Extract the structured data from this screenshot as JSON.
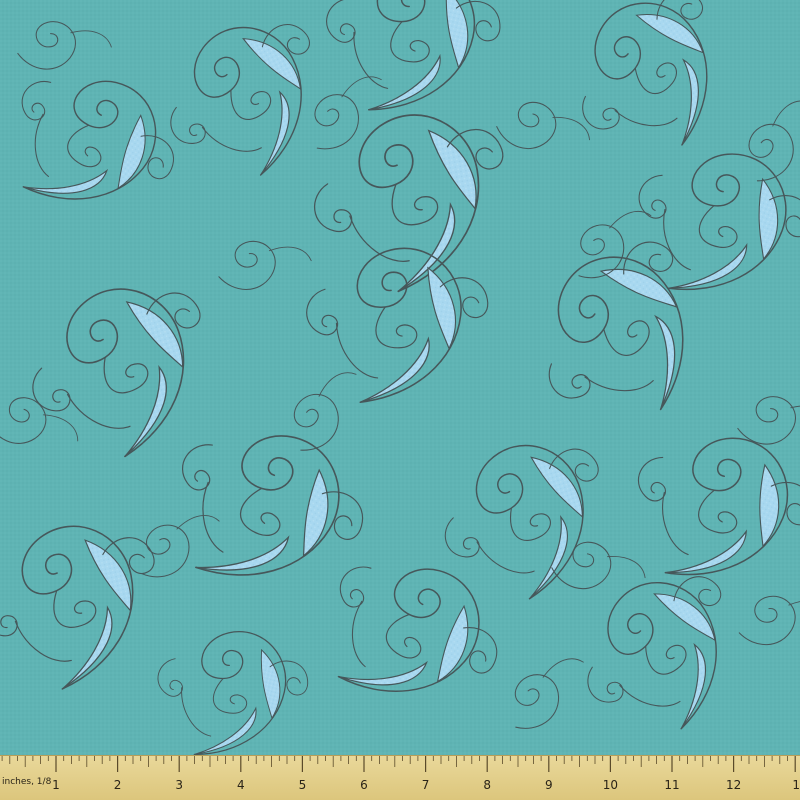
{
  "ruler": {
    "unit_label": "inches, 1/8",
    "numbers": [
      "1",
      "2",
      "3",
      "4",
      "5",
      "6",
      "7",
      "8",
      "9",
      "10",
      "11",
      "12",
      "1"
    ]
  },
  "colors": {
    "fabric_background": "#5fb4b4",
    "swirl_fill": "#a8d8f0",
    "outline": "#46575a",
    "ruler_fill": "#e3cf8b",
    "ruler_tick": "#5a4a2a"
  }
}
